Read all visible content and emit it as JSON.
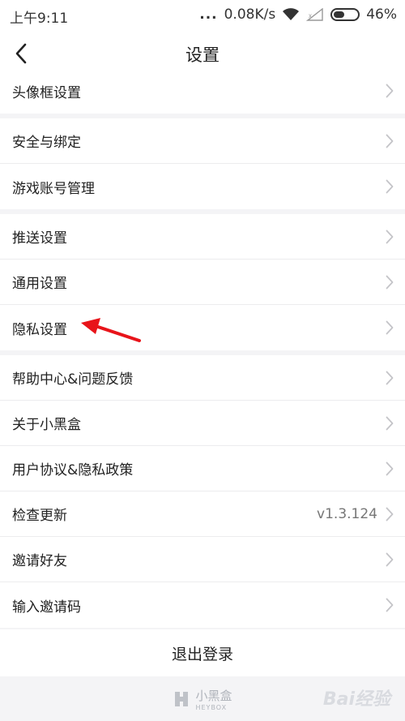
{
  "status_bar": {
    "time": "上午9:11",
    "dots": "...",
    "network_speed": "0.08K/s",
    "battery_percent": "46%",
    "battery_level": 0.46
  },
  "nav": {
    "title": "设置",
    "back_icon": "chevron-left-icon"
  },
  "groups": [
    {
      "items": [
        {
          "label": "头像框设置"
        }
      ]
    },
    {
      "items": [
        {
          "label": "安全与绑定"
        },
        {
          "label": "游戏账号管理"
        }
      ]
    },
    {
      "items": [
        {
          "label": "推送设置"
        },
        {
          "label": "通用设置"
        },
        {
          "label": "隐私设置"
        }
      ]
    },
    {
      "items": [
        {
          "label": "帮助中心&问题反馈"
        },
        {
          "label": "关于小黑盒"
        },
        {
          "label": "用户协议&隐私政策"
        },
        {
          "label": "检查更新",
          "value": "v1.3.124"
        },
        {
          "label": "邀请好友"
        },
        {
          "label": "输入邀请码"
        }
      ]
    }
  ],
  "logout_label": "退出登录",
  "brand": {
    "name": "小黑盒",
    "sub": "HEYBOX"
  },
  "watermark": "Bai经验",
  "colors": {
    "annotation": "#e8141a",
    "chevron": "#c4c4c8"
  }
}
